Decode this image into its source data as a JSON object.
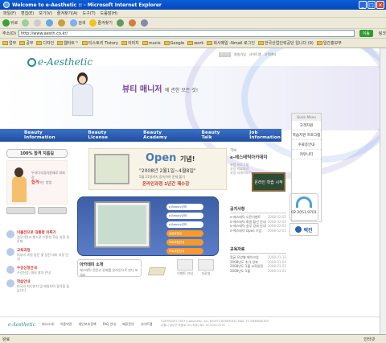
{
  "window": {
    "title": "Welcome to e-Aesthetic :: - Microsoft Internet Explorer"
  },
  "menu": [
    "파일(F)",
    "편집(E)",
    "보기(V)",
    "즐겨찾기(A)",
    "도구(T)",
    "도움말(H)"
  ],
  "toolbar": {
    "back": "뒤로",
    "search": "검색",
    "favorites": "즐겨찾기"
  },
  "address": {
    "label": "주소(D)",
    "url": "http://www.aesth.co.kr/",
    "go": "이동",
    "links": "링크"
  },
  "links_bar": [
    "업무",
    "공부",
    "디자인",
    "웹타트™",
    "티스토리 Tistory",
    "이미지",
    "mucis",
    "Google",
    "work",
    "회사메일 -Nmail 로그인",
    "한국산업인력공단 입니다 (9)",
    "일간홍보부"
  ],
  "status": {
    "text": "완료",
    "zone": "인터넷"
  },
  "site": {
    "toplinks": [
      "로그인",
      "회원가입",
      "사이트맵",
      "고객센터"
    ],
    "logo": "e-Aesthetic",
    "headline": "뷰티 매니저",
    "headline_sub": "에 관한 모든 것!",
    "nav": [
      "Beauty Information",
      "Beauty License",
      "Beauty Academy",
      "Beauty Talk",
      "Job Information"
    ],
    "badge": "100% 합격 지름길",
    "promo_text": "두라다국립미용재료 대회장",
    "promo_red": "합격",
    "promo_sub": "하는 방법",
    "left_menu": [
      {
        "title": "이돌전으로 대통령 이루기",
        "sub": "실무이론과 핸드폰 이용한 학습 과정 및 문제"
      },
      {
        "title": "교육과정",
        "sub": "피부미 과정 방문 및 실전 대비 과정 안내"
      },
      {
        "title": "수강신청안내",
        "sub": "수강신청, 해외 절차 안내"
      },
      {
        "title": "학습안내",
        "sub": "미국의 최신분자 및 매칭하여 합격을 돕습니다"
      }
    ],
    "open": {
      "title": "Open",
      "title2": "기념!",
      "date": "\"2008년 2월1일~4월8일\"",
      "desc": "5월 21일까지 접속하여 문제 풀기",
      "red": "온라인과정 1년간 재수강"
    },
    "center": {
      "t1": "가보",
      "t2": "e-에스테틱아카데미",
      "links": [
        "과정 프로그램",
        "과정 리뷰보기",
        "과정 자세히보기"
      ]
    },
    "chalk": "온라인 학습 시작",
    "quick": {
      "title": "Quick Menu",
      "items": [
        "고객지원",
        "학습지원 프로그램",
        "수료증안내",
        "커뮤니티"
      ]
    },
    "blue_buttons": [
      "e-Beauty강좌",
      "e-Beauty강좌",
      "e-Beauty강좌",
      "실습동영상",
      "프로과정안내",
      "프로과정안내"
    ],
    "academy": {
      "title": "아카데미 소개",
      "desc": "에스테틱 전문교 강좌를 온라인으로 만나 보세요"
    },
    "small_icons": [
      "이벤트 안내",
      "자료실"
    ],
    "notice": {
      "title": "공지사항",
      "rows": [
        {
          "t": "e-에스테틱 오픈이벤트",
          "d": "2008-02-05"
        },
        {
          "t": "e-에스테틱 회원 할인 안내",
          "d": "2008-02-05"
        },
        {
          "t": "e-에스테틱 실무 강좌 안내",
          "d": "2008-02-05"
        },
        {
          "t": "e-에스테틱 Open 기념",
          "d": "2008-02-05"
        }
      ]
    },
    "news": {
      "title": "교육자료",
      "rows": [
        {
          "t": "얼굴 모양별 메이크업",
          "d": "2008-01-15"
        },
        {
          "t": "2008년도 추가 강좌",
          "d": "2008-01-04"
        },
        {
          "t": "2008년도 1월 교육일정",
          "d": "2008-01-02"
        },
        {
          "t": "2008년도 1월",
          "d": "2008-01-02"
        }
      ]
    },
    "tel": "02.2051.9701",
    "partner": "렉컨",
    "footer_links": [
      "회사소개",
      "이용약관",
      "개인보호정책",
      "FAQ 안내",
      "제휴문의",
      "사이트맵"
    ],
    "copyright": "COPYRIGHT 2007 e-Aesthetic. ALL RIGHTS RESERVED. MAIL TO WEBMASTER",
    "address_line": "서울시 강남구 학동로 00 (지하) TEL 02.2051.9701"
  }
}
